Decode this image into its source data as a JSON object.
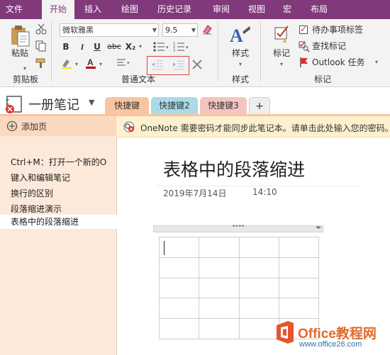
{
  "menu": {
    "tabs": [
      {
        "label": "文件"
      },
      {
        "label": "开始"
      },
      {
        "label": "插入"
      },
      {
        "label": "绘图"
      },
      {
        "label": "历史记录"
      },
      {
        "label": "审阅"
      },
      {
        "label": "视图"
      },
      {
        "label": "宏"
      },
      {
        "label": "布局"
      }
    ],
    "active_tab": "开始",
    "colors": {
      "bar": "#80397b",
      "active_bg": "#f3f3f3"
    }
  },
  "ribbon": {
    "clipboard": {
      "paste_label": "粘贴",
      "group_label": "剪贴板"
    },
    "basic_text": {
      "font_name": "微软雅黑",
      "font_size": "9.5",
      "bold": "B",
      "italic": "I",
      "underline": "U",
      "strike": "abc",
      "subscript": "X₂",
      "group_label": "普通文本"
    },
    "styles": {
      "label": "样式",
      "group_label": "样式"
    },
    "tags": {
      "tag_label": "标记",
      "todo_label": "待办事项标签",
      "find_label": "查找标记",
      "outlook_label": "Outlook 任务",
      "group_label": "标记"
    }
  },
  "notebook": {
    "name": "一册笔记",
    "sections": [
      {
        "label": "快捷键",
        "color": "#f7c59f"
      },
      {
        "label": "快捷键2",
        "color": "#a9dbe8"
      },
      {
        "label": "快捷键3",
        "color": "#f4c6c0"
      },
      {
        "label": "+",
        "color": "#eeeeee"
      }
    ]
  },
  "pages": {
    "add_label": "添加页",
    "items": [
      {
        "label": "Ctrl+M：打开一个新的O"
      },
      {
        "label": "键入和编辑笔记"
      },
      {
        "label": "换行的区别"
      },
      {
        "label": "段落缩进演示"
      },
      {
        "label": "表格中的段落缩进"
      }
    ],
    "selected": "表格中的段落缩进"
  },
  "infobar": {
    "message": "OneNote 需要密码才能同步此笔记本。请单击此处输入您的密码。"
  },
  "page": {
    "title": "表格中的段落缩进",
    "date": "2019年7月14日",
    "time": "14:10",
    "table_handle": "••••",
    "table_arrows": "◂▸"
  },
  "watermark": {
    "brand": "Office教程网",
    "url": "www.office26.com"
  }
}
